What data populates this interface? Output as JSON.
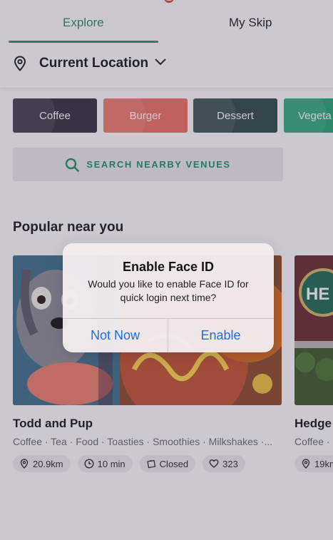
{
  "tabs": {
    "explore": "Explore",
    "my_skip": "My Skip"
  },
  "location": {
    "label": "Current Location"
  },
  "categories": [
    "Coffee",
    "Burger",
    "Dessert",
    "Vegeta"
  ],
  "search": {
    "label": "SEARCH NEARBY VENUES"
  },
  "popular": {
    "title": "Popular near you",
    "venues": [
      {
        "name": "Todd and Pup",
        "tags": "Coffee · Tea · Food · Toasties · Smoothies · Milkshakes ·...",
        "distance": "20.9km",
        "time": "10 min",
        "status": "Closed",
        "likes": "323",
        "sign_text": ""
      },
      {
        "name": "Hedge",
        "tags": "Coffee ·",
        "distance": "19km",
        "sign_text": "HE"
      }
    ]
  },
  "alert": {
    "title": "Enable Face ID",
    "message": "Would you like to enable Face ID for quick login next time?",
    "cancel_label": "Not Now",
    "confirm_label": "Enable"
  },
  "colors": {
    "accent": "#1f8f66",
    "ios_blue": "#1a6fe0",
    "burger": "#ef6f64",
    "coffee": "#34303f",
    "dessert": "#2f4a48",
    "vegetarian": "#23a873"
  },
  "icons": [
    "map-pin-icon",
    "chevron-down-icon",
    "search-icon",
    "clock-icon",
    "closed-bag-icon",
    "heart-icon"
  ]
}
